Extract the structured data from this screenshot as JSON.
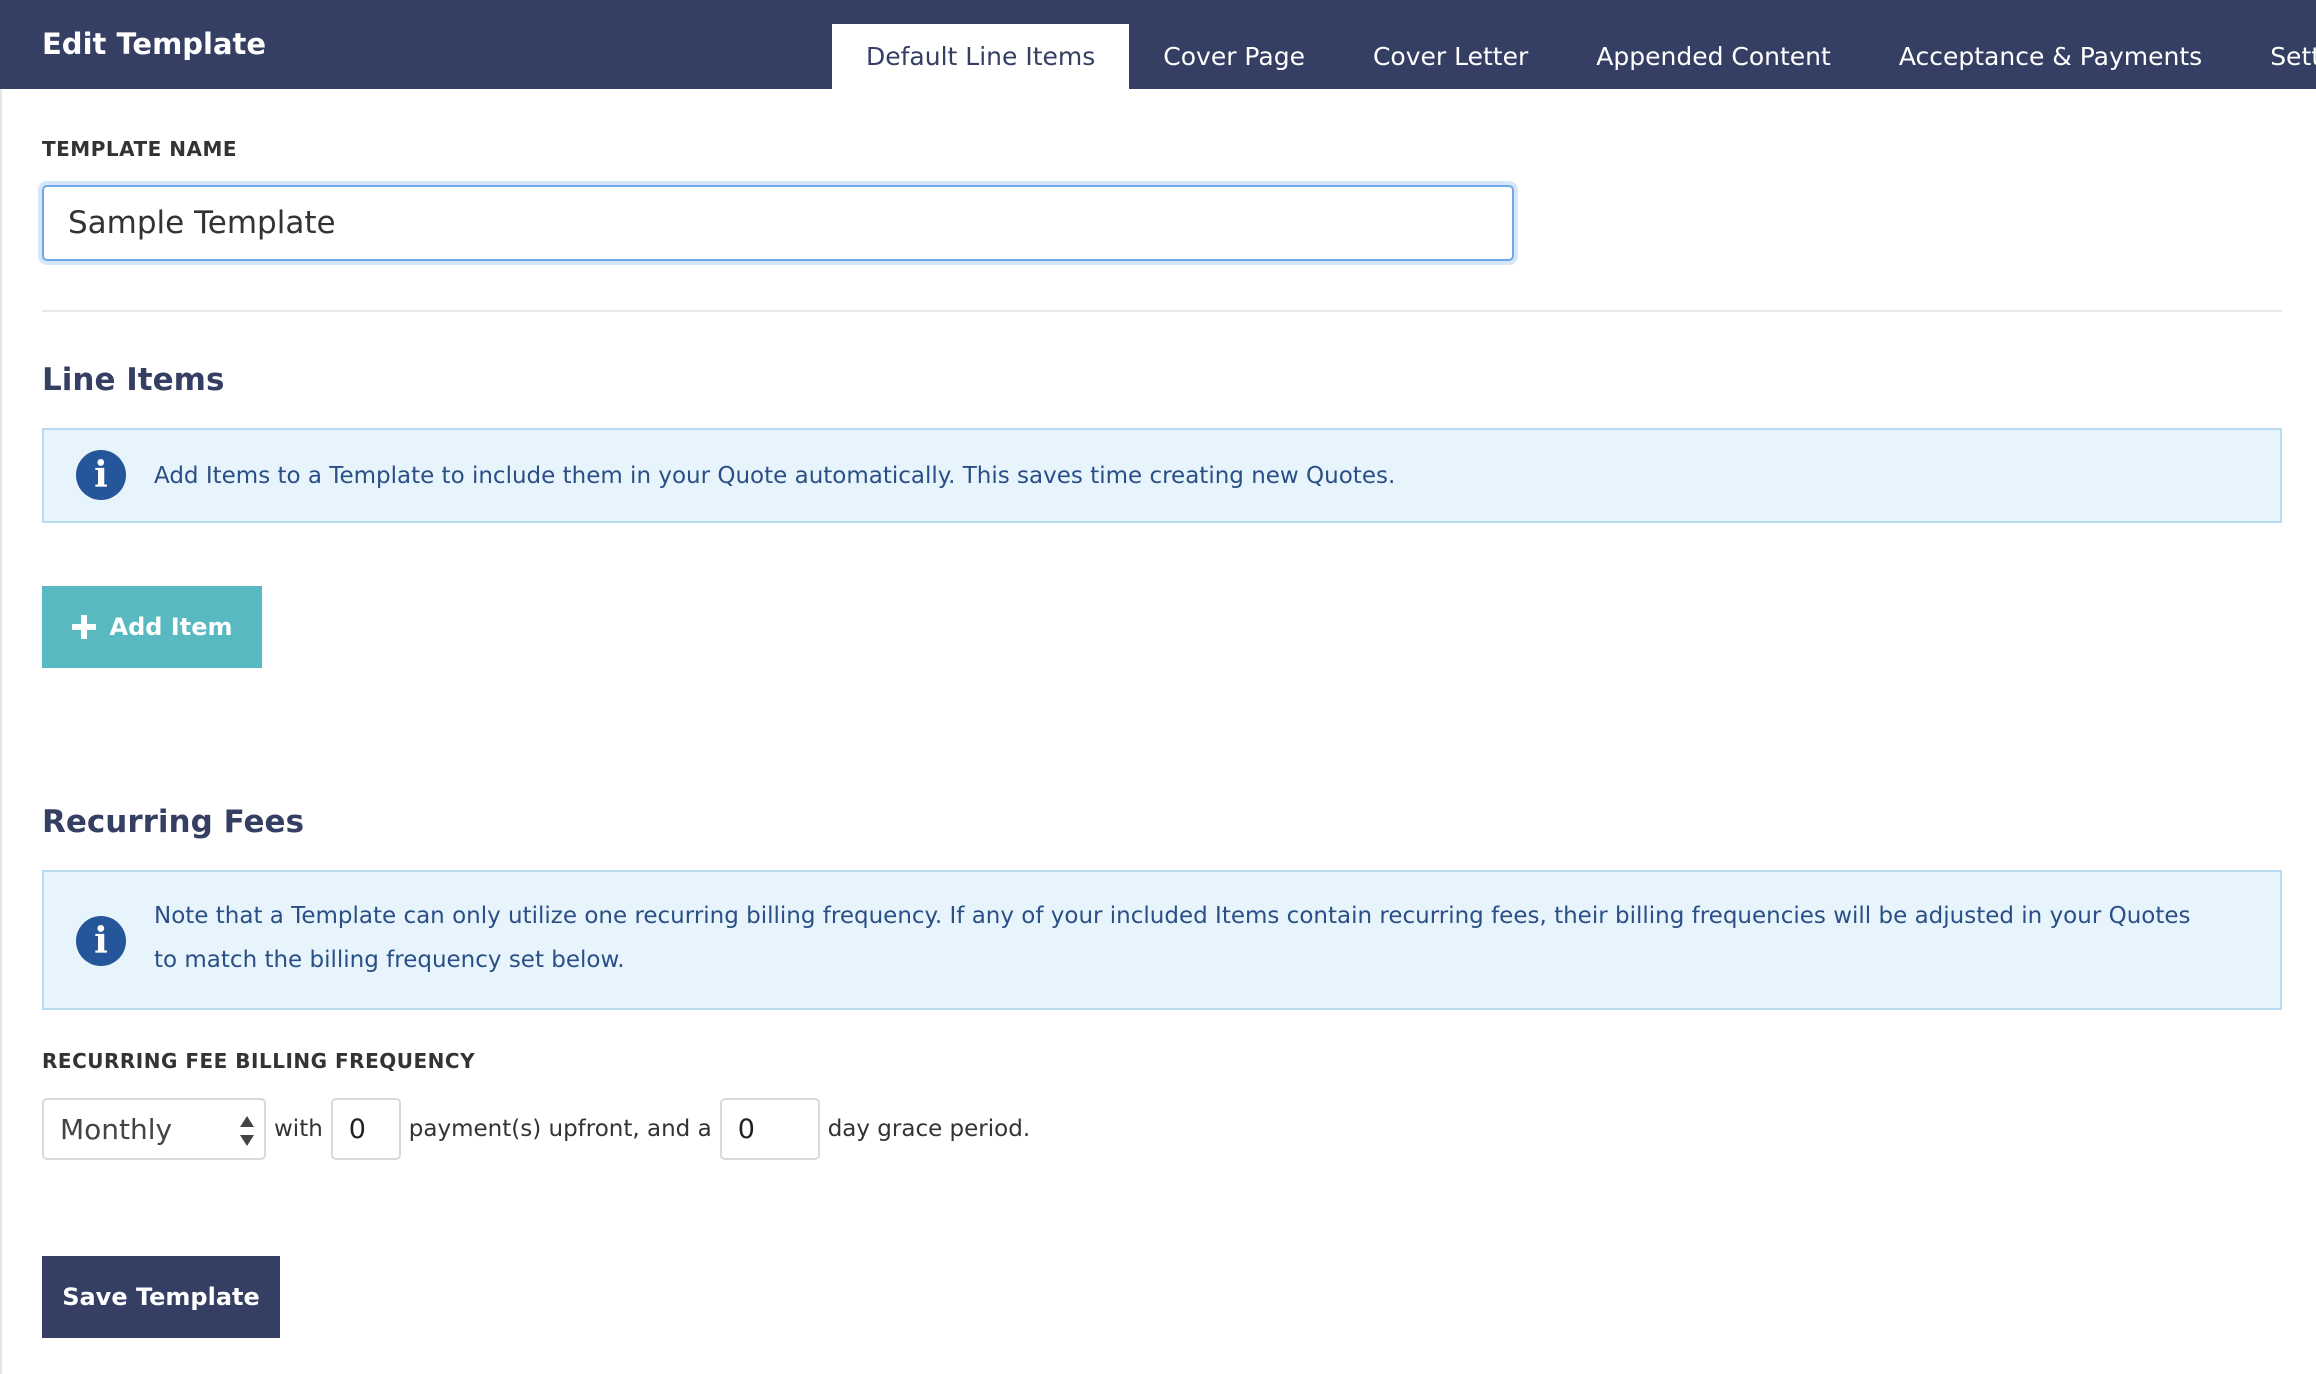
{
  "header": {
    "title": "Edit Template",
    "tabs": [
      {
        "label": "Default Line Items",
        "active": true
      },
      {
        "label": "Cover Page",
        "active": false
      },
      {
        "label": "Cover Letter",
        "active": false
      },
      {
        "label": "Appended Content",
        "active": false
      },
      {
        "label": "Acceptance & Payments",
        "active": false
      },
      {
        "label": "Settings",
        "active": false
      }
    ]
  },
  "template_name": {
    "label": "TEMPLATE NAME",
    "value": "Sample Template"
  },
  "line_items": {
    "heading": "Line Items",
    "info": "Add Items to a Template to include them in your Quote automatically. This saves time creating new Quotes.",
    "add_button_label": "Add Item"
  },
  "recurring_fees": {
    "heading": "Recurring Fees",
    "info": "Note that a Template can only utilize one recurring billing frequency. If any of your included Items contain recurring fees, their billing frequencies will be adjusted in your Quotes to match the billing frequency set below.",
    "frequency_label": "RECURRING FEE BILLING FREQUENCY",
    "frequency_value": "Monthly",
    "with_text": "with",
    "upfront_payments": "0",
    "upfront_text": "payment(s) upfront, and a",
    "grace_days": "0",
    "grace_text": "day grace period."
  },
  "save_button_label": "Save Template",
  "colors": {
    "header_bg": "#353f63",
    "accent_teal": "#59b9c1",
    "info_bg": "#e8f4fc",
    "info_icon": "#25569a"
  },
  "icons": {
    "info": "info-circle-icon",
    "add": "plus-icon",
    "select": "select-arrows-icon"
  }
}
